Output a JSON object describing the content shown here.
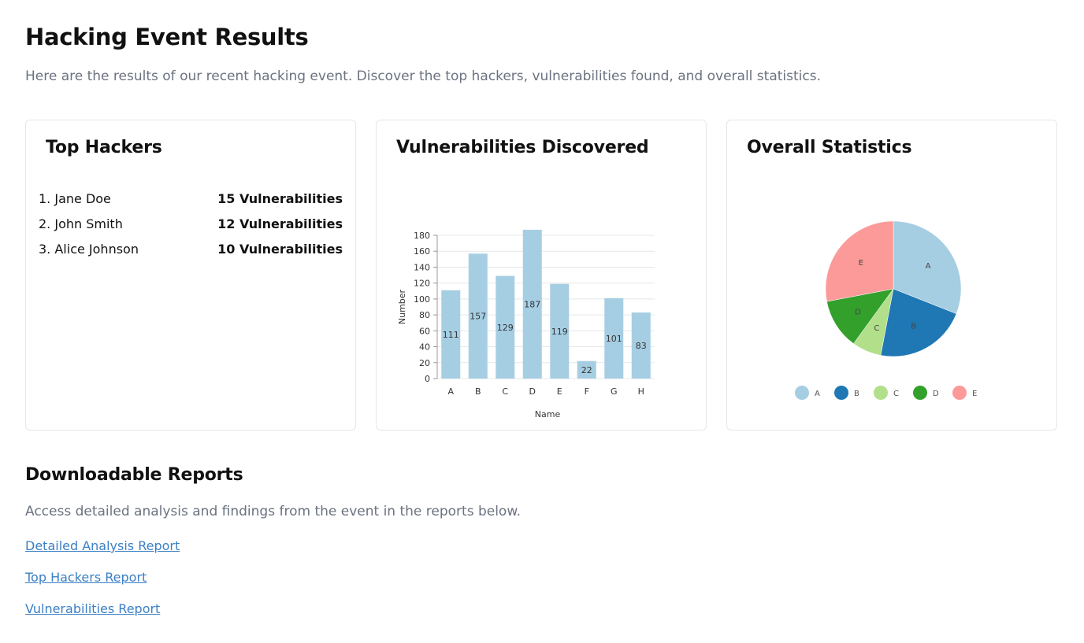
{
  "header": {
    "title": "Hacking Event Results",
    "subtitle": "Here are the results of our recent hacking event. Discover the top hackers, vulnerabilities found, and overall statistics."
  },
  "top_hackers": {
    "title": "Top Hackers",
    "items": [
      {
        "name": "1. Jane Doe",
        "count": "15 Vulnerabilities"
      },
      {
        "name": "2. John Smith",
        "count": "12 Vulnerabilities"
      },
      {
        "name": "3. Alice Johnson",
        "count": "10 Vulnerabilities"
      }
    ]
  },
  "vulnerabilities": {
    "title": "Vulnerabilities Discovered"
  },
  "statistics": {
    "title": "Overall Statistics"
  },
  "chart_data": [
    {
      "type": "bar",
      "categories": [
        "A",
        "B",
        "C",
        "D",
        "E",
        "F",
        "G",
        "H"
      ],
      "values": [
        111,
        157,
        129,
        187,
        119,
        22,
        101,
        83
      ],
      "xlabel": "Name",
      "ylabel": "Number",
      "ylim": [
        0,
        180
      ],
      "yticks": [
        0,
        20,
        40,
        60,
        80,
        100,
        120,
        140,
        160,
        180
      ],
      "grid": true,
      "color": "#a6cee3"
    },
    {
      "type": "pie",
      "labels": [
        "A",
        "B",
        "C",
        "D",
        "E"
      ],
      "values": [
        31,
        22,
        7,
        12,
        28
      ],
      "colors": [
        "#a6cee3",
        "#1f78b4",
        "#b2df8a",
        "#33a02c",
        "#fb9a99"
      ],
      "legend": "bottom"
    }
  ],
  "reports": {
    "title": "Downloadable Reports",
    "subtitle": "Access detailed analysis and findings from the event in the reports below.",
    "links": [
      "Detailed Analysis Report",
      "Top Hackers Report",
      "Vulnerabilities Report"
    ]
  }
}
